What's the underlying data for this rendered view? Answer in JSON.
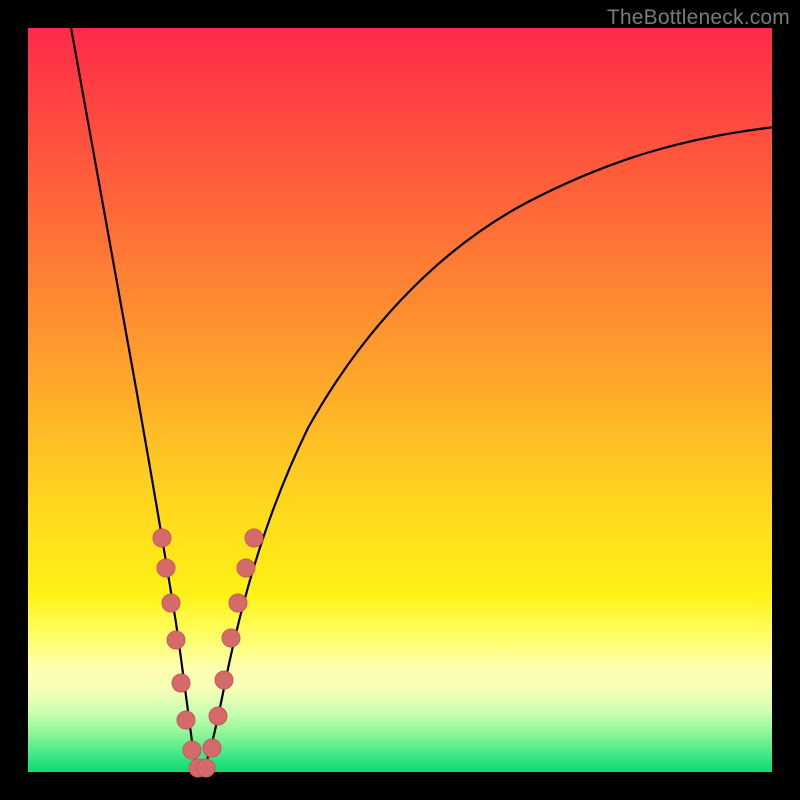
{
  "watermark": "TheBottleneck.com",
  "colors": {
    "frame": "#000000",
    "gradient_top": "#ff2a4a",
    "gradient_mid": "#ffd21f",
    "gradient_bottom": "#16d873",
    "curve": "#000000",
    "marker_fill": "#d66a6b",
    "marker_stroke": "#c25a5c"
  },
  "chart_data": {
    "type": "line",
    "title": "",
    "xlabel": "",
    "ylabel": "",
    "xlim": [
      0,
      100
    ],
    "ylim": [
      0,
      100
    ],
    "description": "Bottleneck-style V-curve: value falls from 100 at x≈5 to 0 at x≈22, then rises asymptotically toward ~85 at x=100. Pink markers cluster on both walls of the V near the minimum (roughly 18–32% on y).",
    "series": [
      {
        "name": "bottleneck-curve",
        "x": [
          5,
          8,
          12,
          16,
          18,
          20,
          21,
          22,
          23,
          24,
          26,
          30,
          35,
          42,
          50,
          60,
          72,
          85,
          100
        ],
        "y": [
          100,
          88,
          70,
          48,
          36,
          20,
          8,
          0,
          4,
          10,
          22,
          38,
          50,
          60,
          68,
          74,
          79,
          82,
          85
        ]
      }
    ],
    "markers": {
      "name": "highlight-points",
      "points": [
        {
          "x": 17.3,
          "y": 32
        },
        {
          "x": 17.9,
          "y": 28
        },
        {
          "x": 18.6,
          "y": 23
        },
        {
          "x": 19.3,
          "y": 18
        },
        {
          "x": 20.0,
          "y": 12
        },
        {
          "x": 20.6,
          "y": 7
        },
        {
          "x": 21.4,
          "y": 3
        },
        {
          "x": 22.0,
          "y": 0.5
        },
        {
          "x": 22.8,
          "y": 0.5
        },
        {
          "x": 23.6,
          "y": 3
        },
        {
          "x": 24.4,
          "y": 8
        },
        {
          "x": 25.2,
          "y": 13
        },
        {
          "x": 26.2,
          "y": 19
        },
        {
          "x": 27.2,
          "y": 24
        },
        {
          "x": 28.3,
          "y": 29
        },
        {
          "x": 29.5,
          "y": 33
        }
      ]
    }
  }
}
